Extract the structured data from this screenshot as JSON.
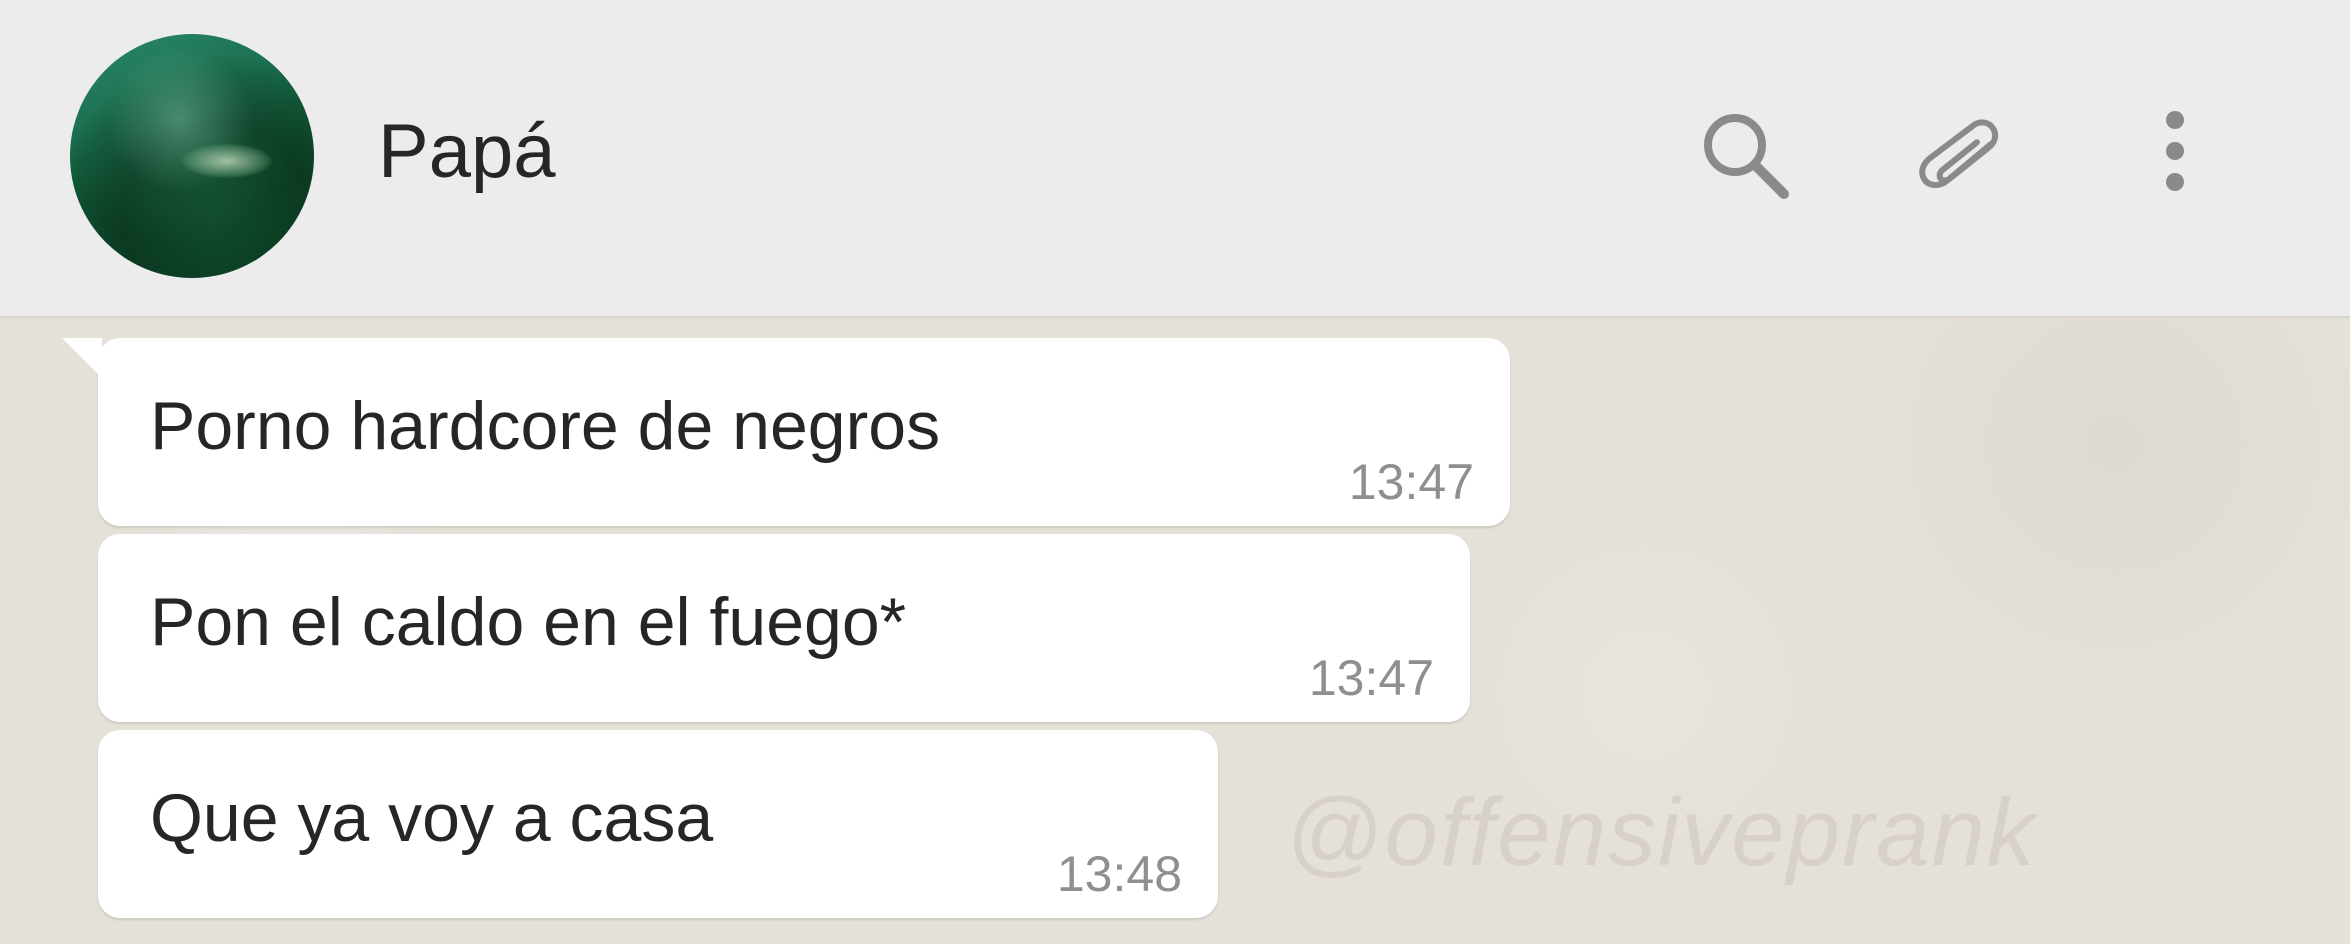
{
  "header": {
    "contact_name": "Papá",
    "icons": [
      "search-icon",
      "paperclip-icon",
      "more-vertical-icon"
    ]
  },
  "messages": [
    {
      "text": "Porno hardcore de negros",
      "time": "13:47"
    },
    {
      "text": "Pon el caldo en el fuego*",
      "time": "13:47"
    },
    {
      "text": "Que ya voy a casa",
      "time": "13:48"
    }
  ],
  "watermark": "@offensiveprank",
  "colors": {
    "header_bg": "#ececec",
    "chat_bg": "#e5e0d8",
    "bubble_bg": "#ffffff",
    "icon": "#8a8a8a",
    "time": "#8f8f8f"
  }
}
